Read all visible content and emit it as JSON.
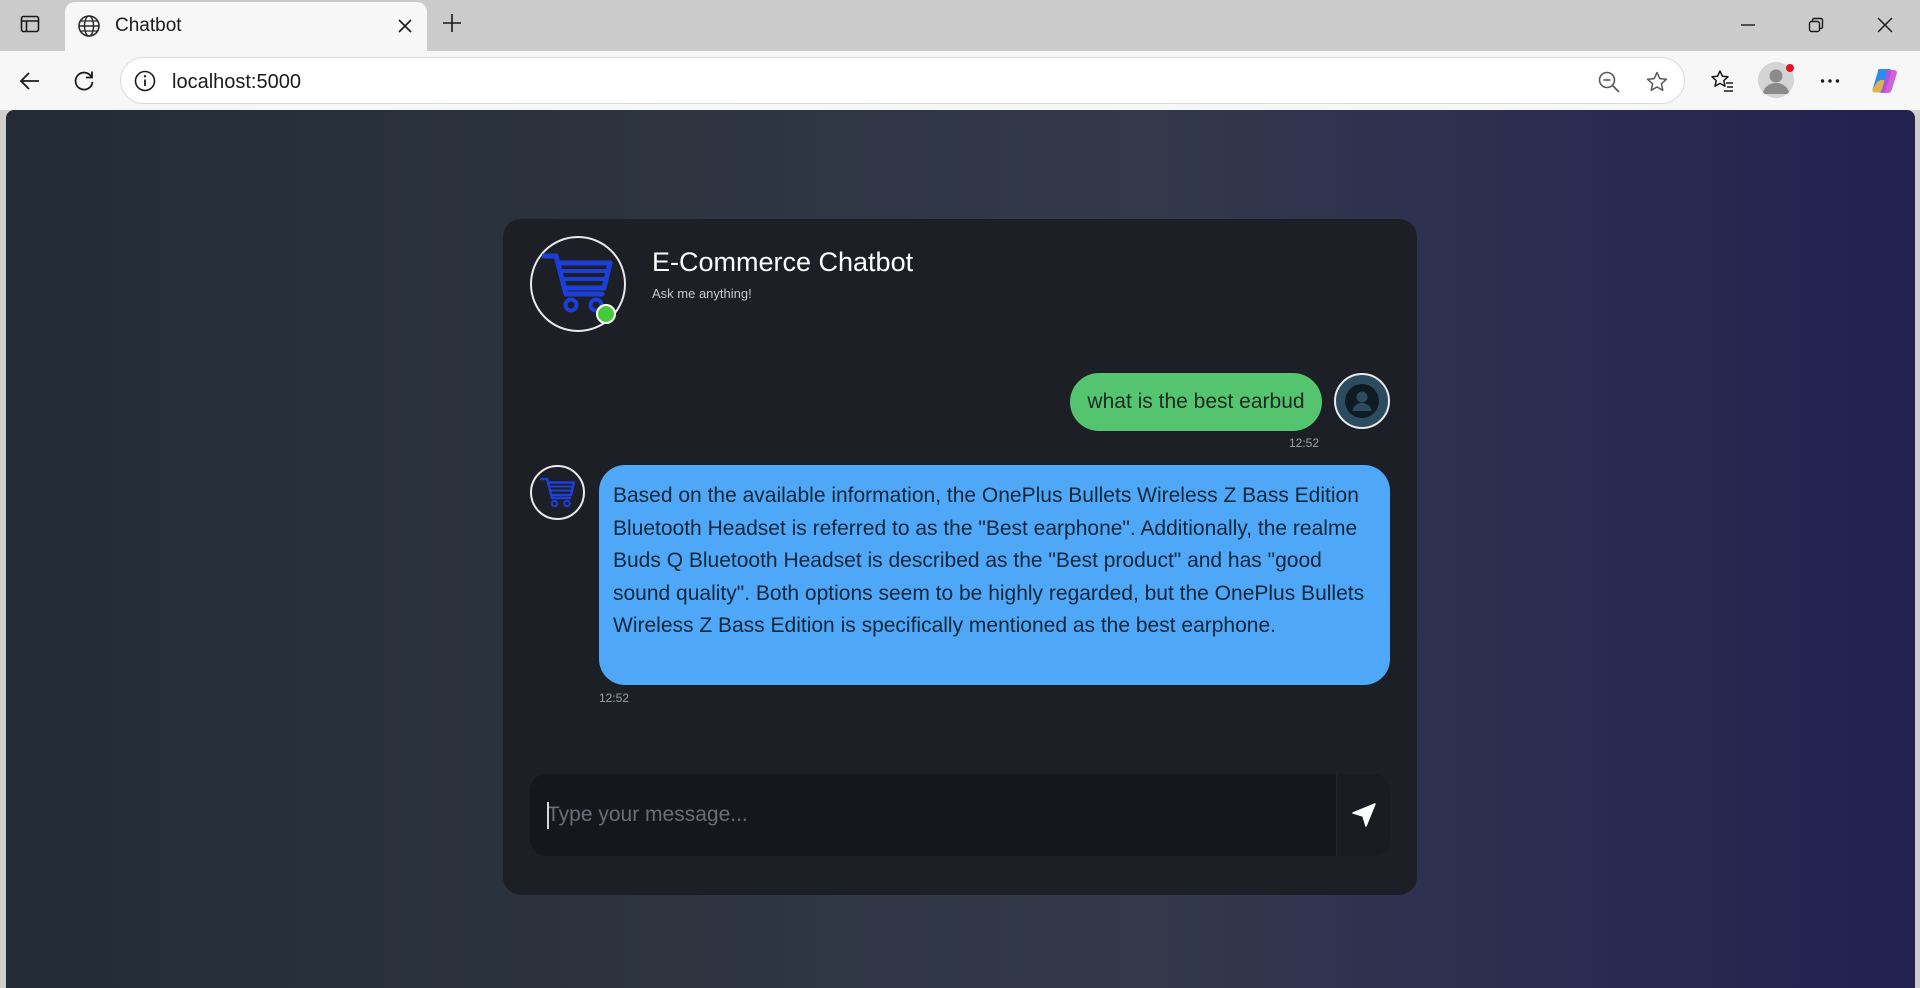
{
  "browser": {
    "tab_title": "Chatbot",
    "url": "localhost:5000",
    "icons": [
      "sidebar-toggle-icon",
      "globe-icon",
      "close-icon",
      "plus-icon",
      "minimize-icon",
      "restore-icon",
      "window-close-icon",
      "back-icon",
      "refresh-icon",
      "info-icon",
      "zoom-out-icon",
      "star-icon",
      "favorites-icon",
      "profile-icon",
      "more-icon",
      "copilot-icon"
    ]
  },
  "chat": {
    "title": "E-Commerce Chatbot",
    "subtitle": "Ask me anything!",
    "status": "online",
    "messages": [
      {
        "sender": "user",
        "text": "what is the best earbud",
        "time": "12:52"
      },
      {
        "sender": "bot",
        "text": "Based on the available information, the OnePlus Bullets Wireless Z Bass Edition Bluetooth Headset is referred to as the \"Best earphone\". Additionally, the realme Buds Q Bluetooth Headset is described as the \"Best product\" and has \"good sound quality\". Both options seem to be highly regarded, but the OnePlus Bullets Wireless Z Bass Edition is specifically mentioned as the best earphone.",
        "time": "12:52"
      }
    ],
    "input": {
      "value": "",
      "placeholder": "Type your message..."
    }
  },
  "colors": {
    "user_bubble": "#54c46f",
    "bot_bubble": "#4ea8f7",
    "card": "#1d1f27",
    "online": "#46c93a",
    "cart_icon": "#1c3fd9"
  }
}
